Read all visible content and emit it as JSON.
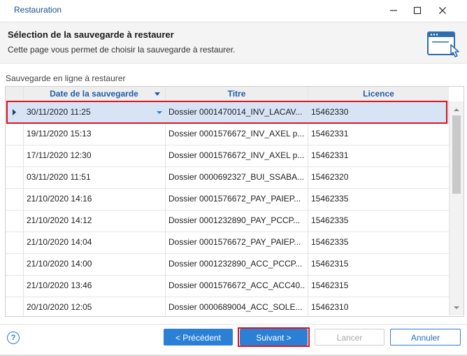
{
  "window": {
    "title": "Restauration",
    "minimize_icon": "minimize-icon",
    "maximize_icon": "maximize-icon",
    "close_icon": "close-icon"
  },
  "header": {
    "heading": "Sélection de la sauvegarde à restaurer",
    "description": "Cette page vous permet de choisir la sauvegarde à restaurer.",
    "illustration_icon": "window-cursor-icon"
  },
  "section_label": "Sauvegarde en ligne à restaurer",
  "grid": {
    "columns": [
      "Date de la sauvegarde",
      "Titre",
      "Licence"
    ],
    "sort_icon": "sort-desc-icon",
    "selected_index": 0,
    "rows": [
      {
        "date": "30/11/2020 11:25",
        "titre": "Dossier 0001470014_INV_LACAV...",
        "licence": "15462330"
      },
      {
        "date": "19/11/2020 15:13",
        "titre": "Dossier 0001576672_INV_AXEL p...",
        "licence": "15462331"
      },
      {
        "date": "17/11/2020 12:30",
        "titre": "Dossier 0001576672_INV_AXEL p...",
        "licence": "15462331"
      },
      {
        "date": "03/11/2020 11:51",
        "titre": "Dossier 0000692327_BUI_SSABA...",
        "licence": "15462320"
      },
      {
        "date": "21/10/2020 14:16",
        "titre": "Dossier 0001576672_PAY_PAIEP...",
        "licence": "15462335"
      },
      {
        "date": "21/10/2020 14:12",
        "titre": "Dossier 0001232890_PAY_PCCP...",
        "licence": "15462335"
      },
      {
        "date": "21/10/2020 14:04",
        "titre": "Dossier 0001576672_PAY_PAIEP...",
        "licence": "15462335"
      },
      {
        "date": "21/10/2020 14:00",
        "titre": "Dossier 0001232890_ACC_PCCP...",
        "licence": "15462315"
      },
      {
        "date": "21/10/2020 13:46",
        "titre": "Dossier 0001576672_ACC_ACC40...",
        "licence": "15462315"
      },
      {
        "date": "20/10/2020 12:05",
        "titre": "Dossier 0000689004_ACC_SOLE...",
        "licence": "15462310"
      }
    ]
  },
  "footer": {
    "help_icon": "help-icon",
    "previous": "< Précédent",
    "next": "Suivant >",
    "cancel": "Lancer",
    "abort": "Annuler"
  },
  "colors": {
    "accent": "#2b80d6",
    "highlight": "#e0141e",
    "selected_row": "#d6e4f5"
  }
}
